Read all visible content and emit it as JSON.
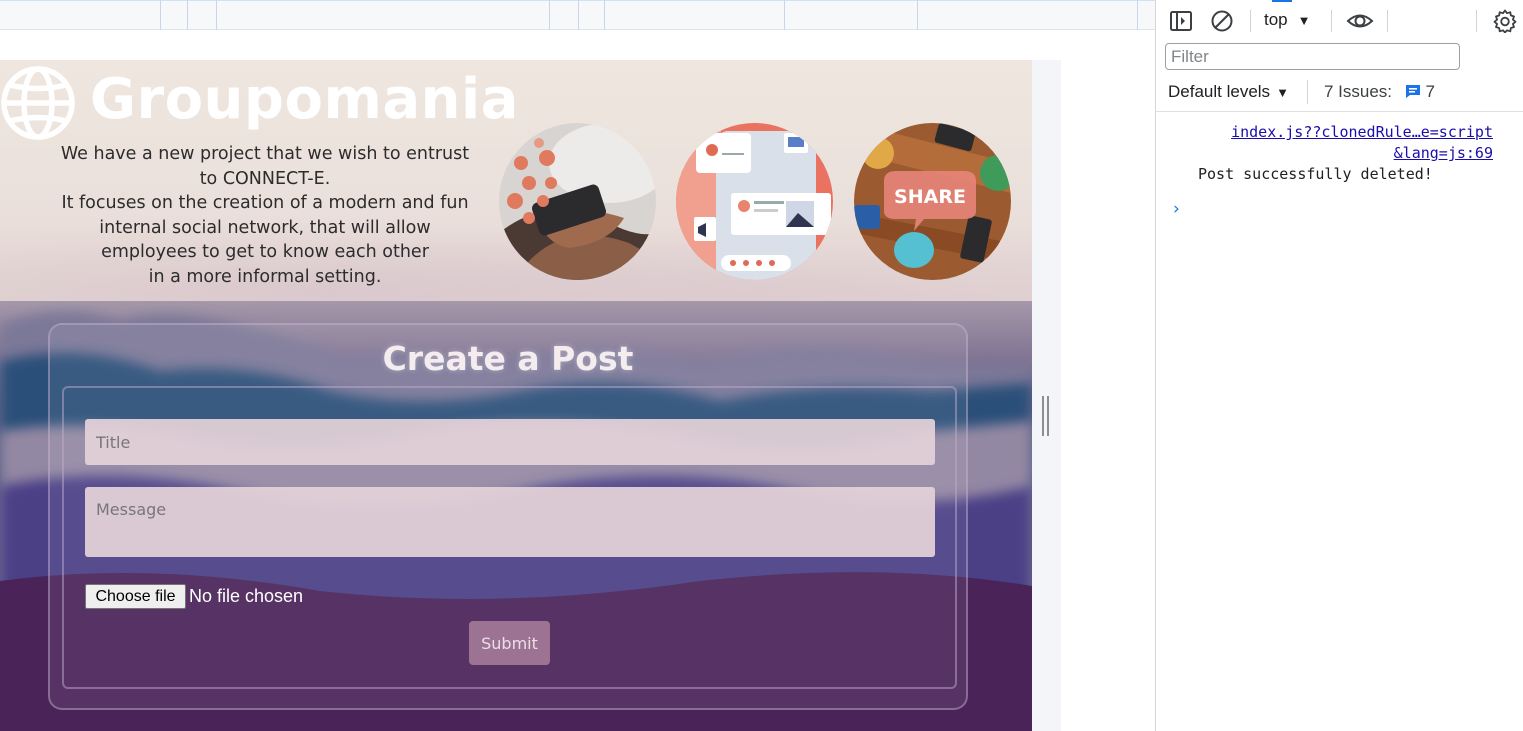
{
  "site": {
    "brand": "Groupomania",
    "intro_lines": [
      "We have a new project that we wish to entrust",
      "to CONNECT-E.",
      "It focuses on the creation of a modern and fun",
      "internal social network, that will allow",
      "employees to get to know each other",
      "in a more informal setting."
    ],
    "share_text": "SHARE"
  },
  "post_form": {
    "heading": "Create a Post",
    "title_placeholder": "Title",
    "message_placeholder": "Message",
    "file_button_label": "Choose file",
    "file_status": "No file chosen",
    "submit_label": "Submit"
  },
  "devtools": {
    "context": "top",
    "filter_placeholder": "Filter",
    "levels_label": "Default levels",
    "issues_label": "7 Issues:",
    "issues_count": "7",
    "log": {
      "source_line1": "index.js??clonedRule…e=script",
      "source_line2": "&lang=js:69",
      "message": "Post successfully deleted!"
    },
    "prompt": "›"
  },
  "colors": {
    "accent": "#1a73e8",
    "submit_bg": "#9d7394",
    "field_bg": "#e5d2d9"
  }
}
